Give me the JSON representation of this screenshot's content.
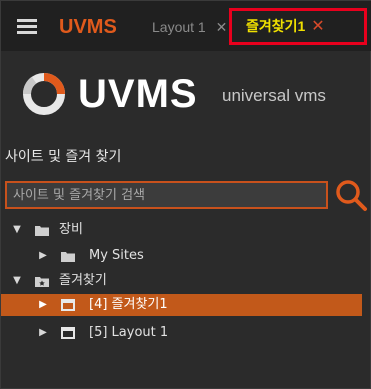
{
  "app": {
    "title": "UVMS"
  },
  "tabs": [
    {
      "label": "Layout 1",
      "close": "✕"
    },
    {
      "label": "즐겨찾기1",
      "close": "✕"
    }
  ],
  "logo": {
    "word": "UVMS",
    "tagline": "universal vms"
  },
  "panel": {
    "title": "사이트 및 즐겨 찾기"
  },
  "search": {
    "placeholder": "사이트 및 즐겨찾기 검색",
    "value": ""
  },
  "tree": {
    "equipment": {
      "label": "장비",
      "icon": "folder-icon",
      "expanded": true
    },
    "my_sites": {
      "label": "My Sites",
      "icon": "folder-icon",
      "expanded": false
    },
    "favorites": {
      "label": "즐겨찾기",
      "icon": "favorites-folder-icon",
      "expanded": true
    },
    "fav_item_1": {
      "label": "[4] 즐겨찾기1",
      "icon": "layout-icon",
      "selected": true
    },
    "fav_item_2": {
      "label": "[5] Layout 1",
      "icon": "layout-icon",
      "selected": false
    }
  },
  "colors": {
    "accent": "#e05a1c",
    "selection": "#c2591a",
    "active_tab_border": "#e8001d",
    "active_tab_text": "#f0e000",
    "background": "#2b2b2b"
  }
}
